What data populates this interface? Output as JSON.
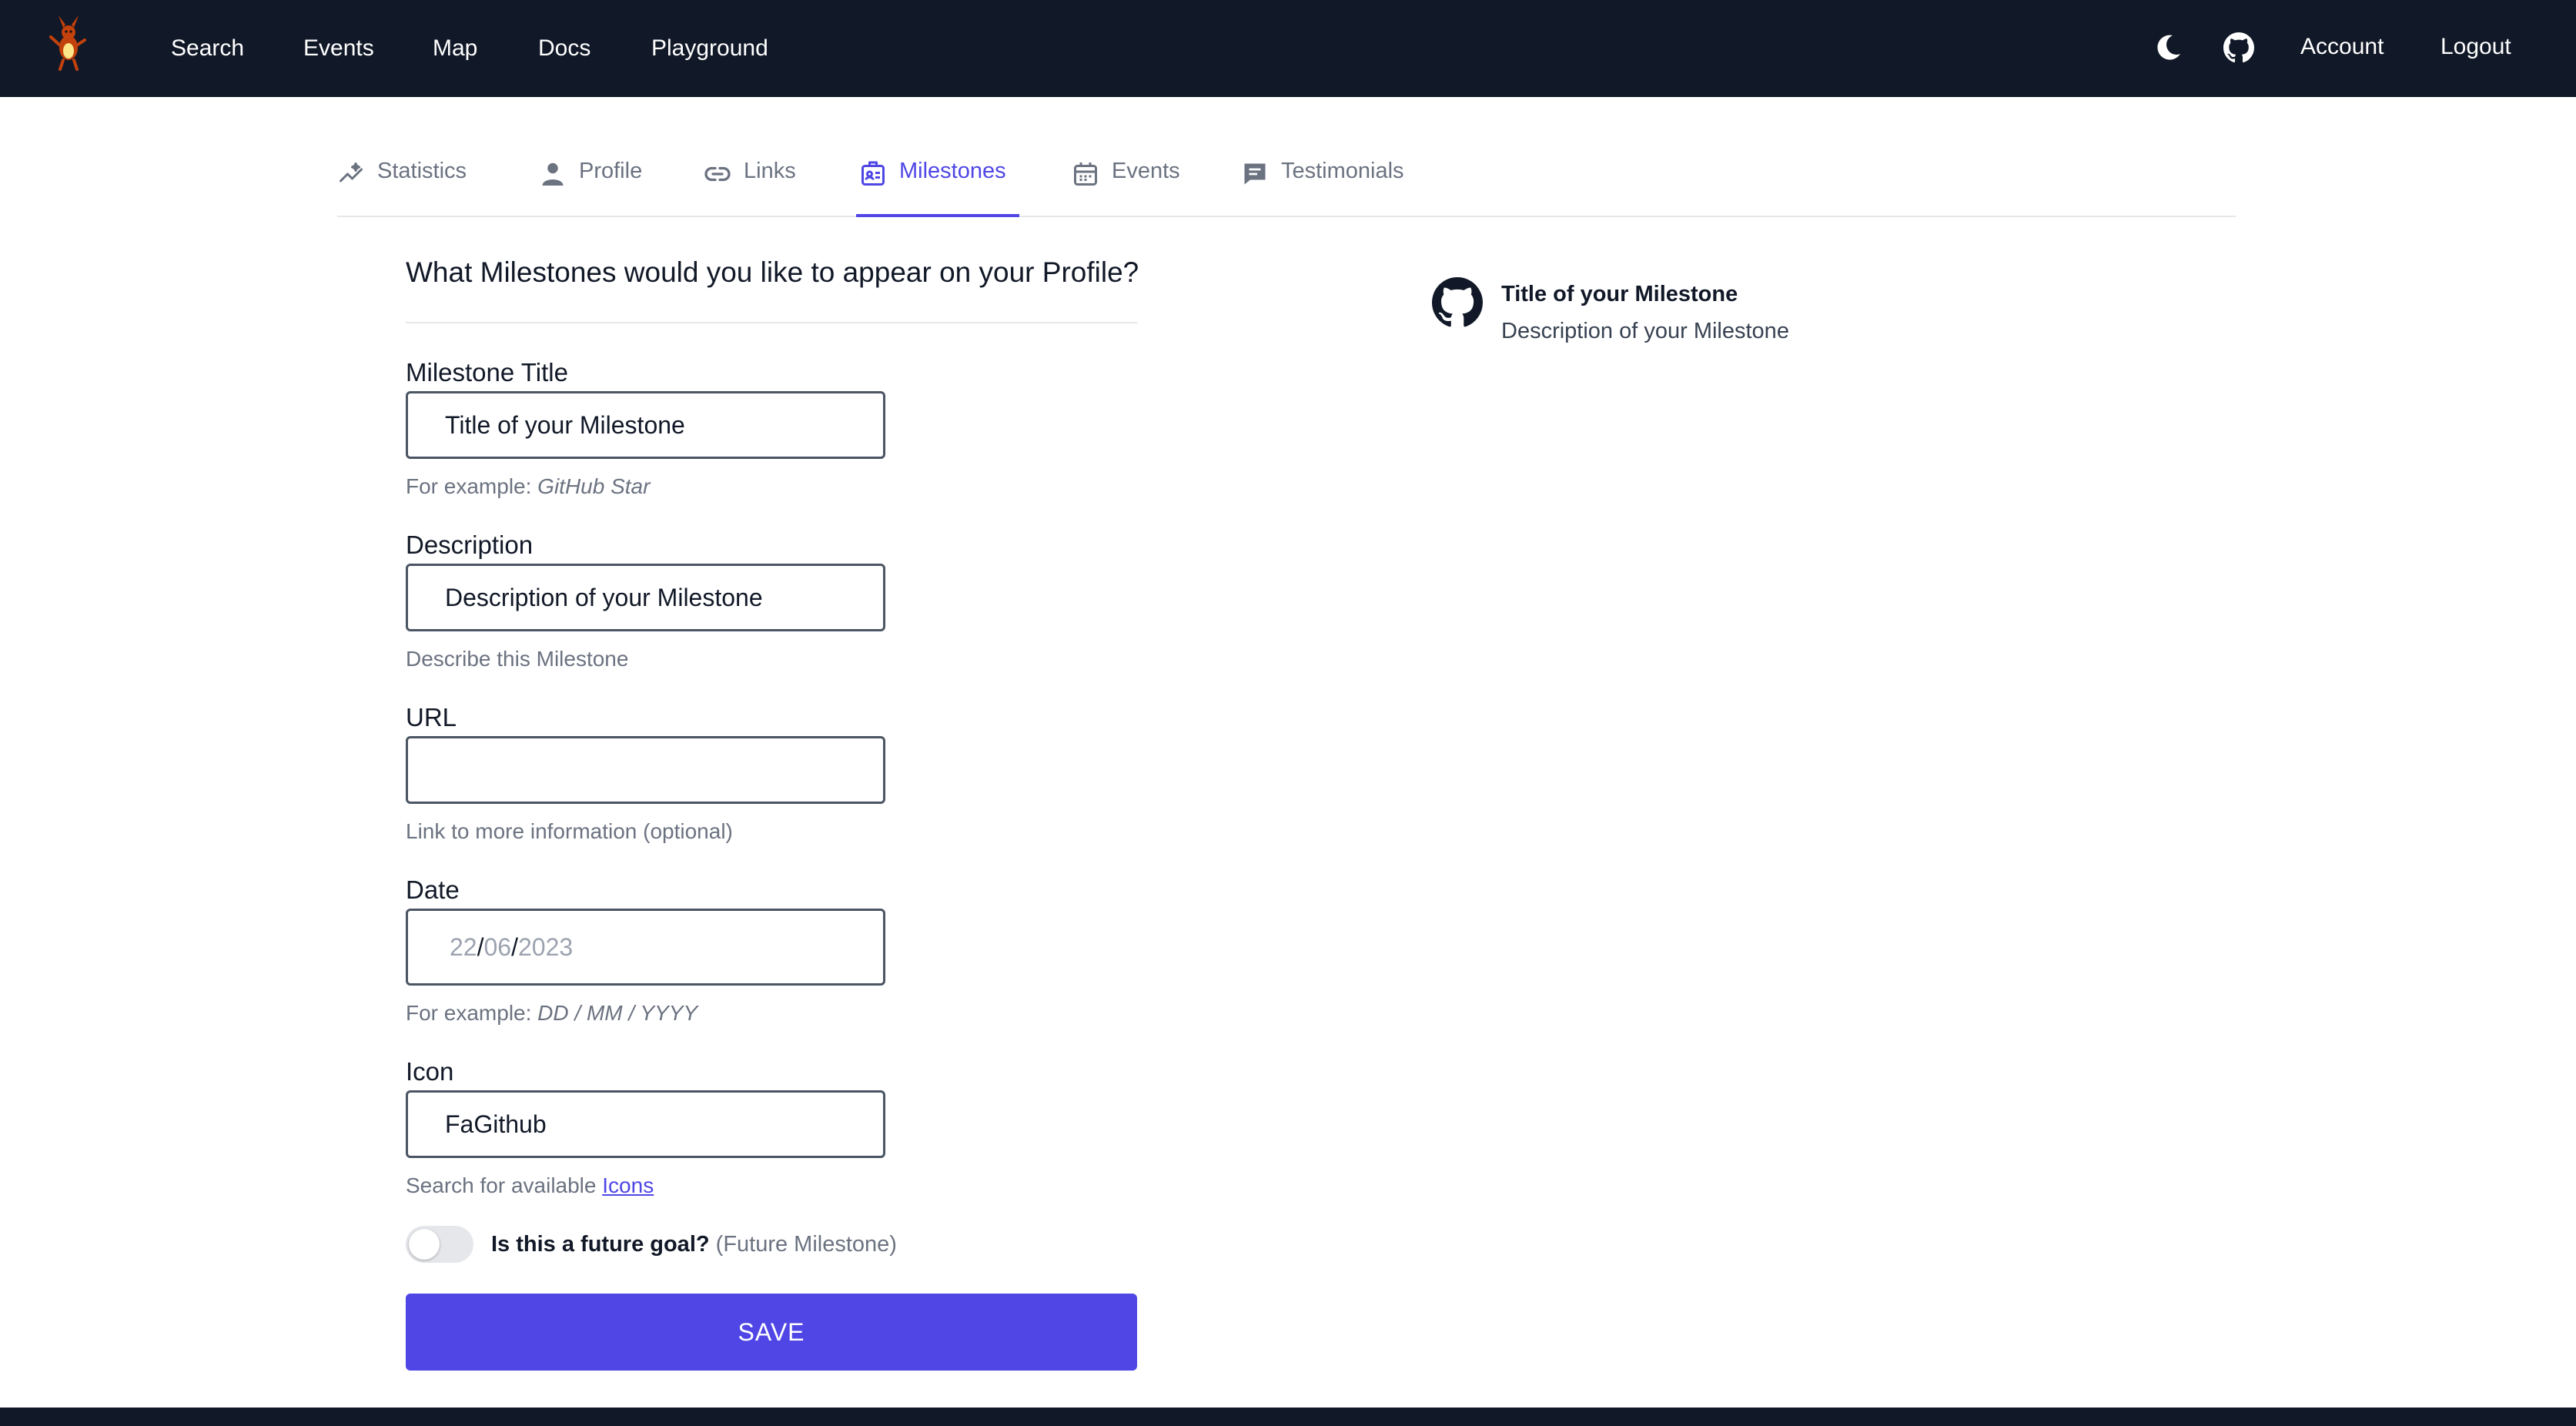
{
  "navbar": {
    "links": [
      "Search",
      "Events",
      "Map",
      "Docs",
      "Playground"
    ],
    "account": "Account",
    "logout": "Logout"
  },
  "tabs": [
    {
      "label": "Statistics",
      "icon": "chart-sparkle-icon"
    },
    {
      "label": "Profile",
      "icon": "user-icon"
    },
    {
      "label": "Links",
      "icon": "link-icon"
    },
    {
      "label": "Milestones",
      "icon": "id-badge-icon",
      "active": true
    },
    {
      "label": "Events",
      "icon": "calendar-icon"
    },
    {
      "label": "Testimonials",
      "icon": "chat-icon"
    }
  ],
  "form": {
    "heading": "What Milestones would you like to appear on your Profile?",
    "title": {
      "label": "Milestone Title",
      "value": "Title of your Milestone",
      "hint_prefix": "For example: ",
      "hint_example": "GitHub Star"
    },
    "description": {
      "label": "Description",
      "value": "Description of your Milestone",
      "hint": "Describe this Milestone"
    },
    "url": {
      "label": "URL",
      "value": "",
      "hint": "Link to more information (optional)"
    },
    "date": {
      "label": "Date",
      "day": "22",
      "month": "06",
      "year": "2023",
      "separator": "/",
      "hint_prefix": "For example: ",
      "hint_example": "DD / MM / YYYY"
    },
    "icon": {
      "label": "Icon",
      "value": "FaGithub",
      "hint_prefix": "Search for available ",
      "hint_link": "Icons"
    },
    "future": {
      "label": "Is this a future goal?",
      "sublabel": "(Future Milestone)",
      "checked": false
    },
    "save": "SAVE"
  },
  "preview": {
    "title": "Title of your Milestone",
    "description": "Description of your Milestone",
    "icon": "github-icon"
  },
  "colors": {
    "navbar": "#111827",
    "accent": "#4f46e5",
    "muted": "#6b7280"
  }
}
